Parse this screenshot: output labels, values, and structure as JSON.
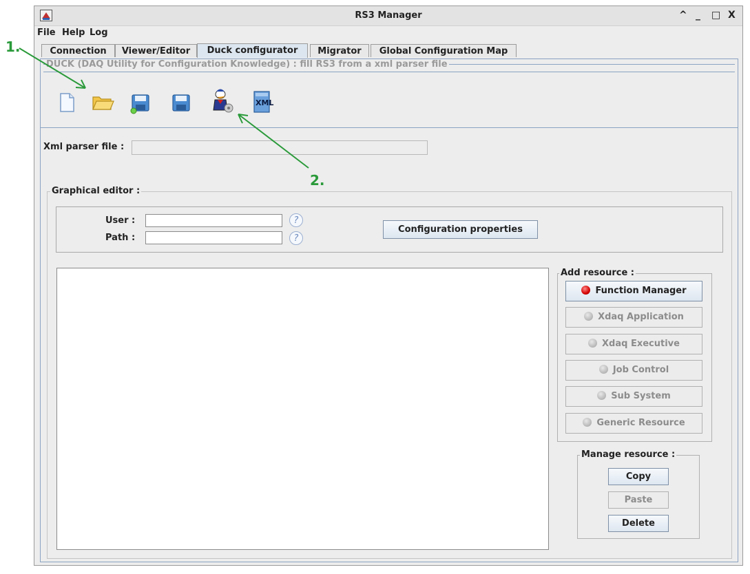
{
  "window": {
    "title": "RS3 Manager",
    "controls": {
      "up": "^",
      "minimize": "_",
      "maximize": "□",
      "close": "X"
    }
  },
  "menu": [
    "File",
    "Help",
    "Log"
  ],
  "tabs": [
    {
      "label": "Connection",
      "active": false
    },
    {
      "label": "Viewer/Editor",
      "active": false
    },
    {
      "label": "Duck configurator",
      "active": true
    },
    {
      "label": "Migrator",
      "active": false
    },
    {
      "label": "Global Configuration Map",
      "active": false
    }
  ],
  "duck_panel": {
    "title": "DUCK (DAQ Utility for Configuration Knowledge) : fill RS3 from a xml parser file",
    "toolbar": [
      "new-file-icon",
      "open-folder-icon",
      "save-icon",
      "save-as-icon",
      "duck-icon",
      "xml-icon"
    ],
    "xml_icon_text": "XML",
    "xml_parser_label": "Xml parser file :",
    "xml_parser_value": ""
  },
  "graphical_editor": {
    "title": "Graphical editor :",
    "user_label": "User :",
    "user_value": "",
    "path_label": "Path :",
    "path_value": "",
    "help_glyph": "?",
    "config_button": "Configuration properties"
  },
  "add_resource": {
    "title": "Add resource :",
    "items": [
      {
        "label": "Function Manager",
        "enabled": true,
        "led": "red"
      },
      {
        "label": "Xdaq Application",
        "enabled": false,
        "led": "gray"
      },
      {
        "label": "Xdaq Executive",
        "enabled": false,
        "led": "gray"
      },
      {
        "label": "Job Control",
        "enabled": false,
        "led": "gray"
      },
      {
        "label": "Sub System",
        "enabled": false,
        "led": "gray"
      },
      {
        "label": "Generic Resource",
        "enabled": false,
        "led": "gray"
      }
    ]
  },
  "manage_resource": {
    "title": "Manage resource :",
    "copy": "Copy",
    "paste": "Paste",
    "delete": "Delete"
  },
  "annotations": {
    "one": "1.",
    "two": "2."
  },
  "colors": {
    "annotation": "#2a9a3a",
    "active_tab": "#dce6f0",
    "border_blue": "#8aa2c2"
  }
}
